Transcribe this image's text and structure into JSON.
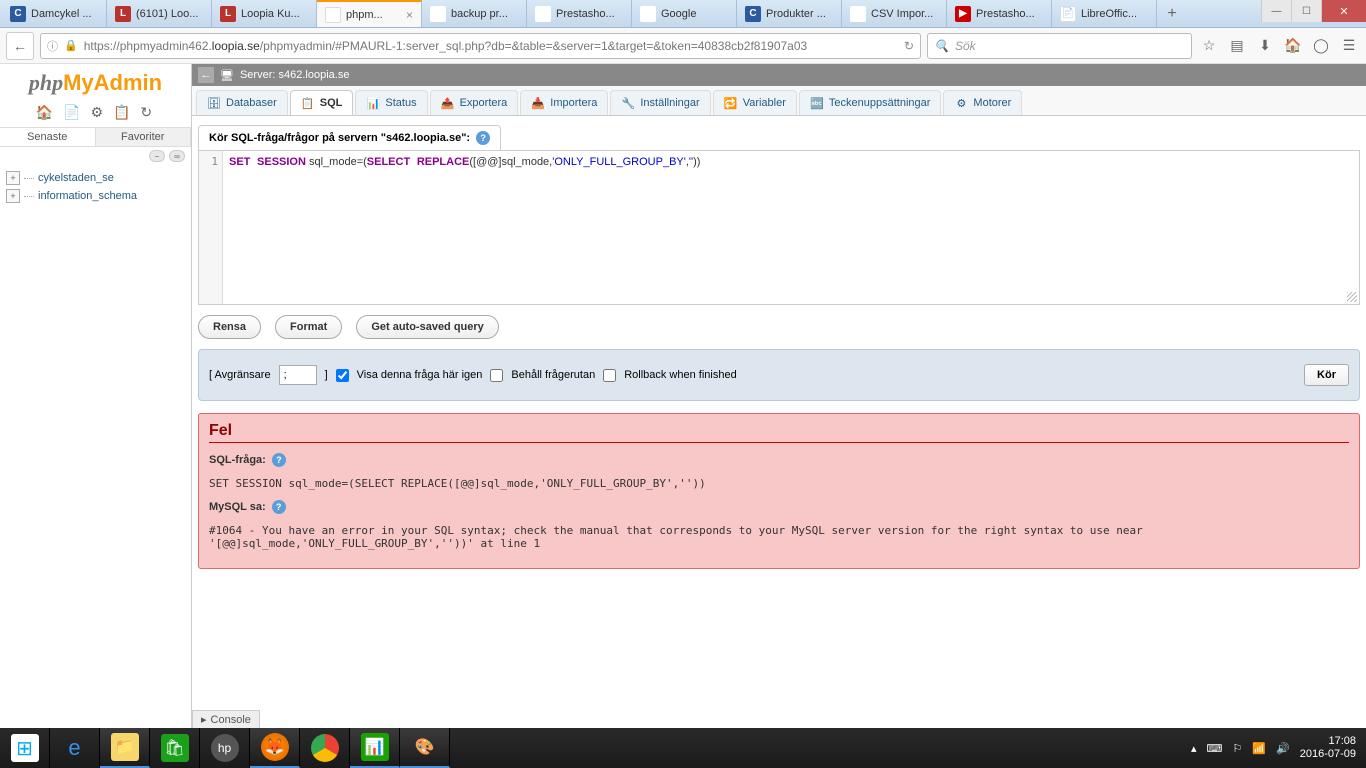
{
  "window": {
    "min": "—",
    "max": "☐"
  },
  "browser_tabs": [
    {
      "icon": "C",
      "icon_class": "fav-c",
      "label": "Damcykel ..."
    },
    {
      "icon": "L",
      "icon_class": "fav-l",
      "label": "(6101) Loo..."
    },
    {
      "icon": "L",
      "icon_class": "fav-l",
      "label": "Loopia Ku..."
    },
    {
      "icon": "⚙",
      "icon_class": "fav-pma",
      "label": "phpm...",
      "active": true,
      "closeable": true
    },
    {
      "icon": "G",
      "icon_class": "fav-g",
      "label": "backup pr..."
    },
    {
      "icon": "⚙",
      "icon_class": "fav-ps",
      "label": "Prestasho..."
    },
    {
      "icon": "G",
      "icon_class": "fav-g",
      "label": "Google"
    },
    {
      "icon": "C",
      "icon_class": "fav-c",
      "label": "Produkter ..."
    },
    {
      "icon": "⚙",
      "icon_class": "fav-ps",
      "label": "CSV Impor..."
    },
    {
      "icon": "▶",
      "icon_class": "fav-yt",
      "label": "Prestasho..."
    },
    {
      "icon": "📄",
      "icon_class": "fav-lo",
      "label": "LibreOffic..."
    }
  ],
  "newtab": "+",
  "url": {
    "prefix": "https://phpmyadmin462.",
    "host": "loopia.se",
    "path": "/phpmyadmin/#PMAURL-1:server_sql.php?db=&table=&server=1&target=&token=40838cb2f81907a03"
  },
  "search_placeholder": "Sök",
  "logo": {
    "php": "php",
    "my": "My",
    "admin": "Admin"
  },
  "sidebar_tabs": {
    "recent": "Senaste",
    "fav": "Favoriter"
  },
  "databases": [
    "cykelstaden_se",
    "information_schema"
  ],
  "breadcrumb": {
    "back": "←",
    "server_label": "Server:",
    "server": "s462.loopia.se"
  },
  "pma_tabs": [
    {
      "icon": "🗄",
      "label": "Databaser"
    },
    {
      "icon": "📋",
      "label": "SQL",
      "active": true
    },
    {
      "icon": "📊",
      "label": "Status"
    },
    {
      "icon": "📤",
      "label": "Exportera"
    },
    {
      "icon": "📥",
      "label": "Importera"
    },
    {
      "icon": "🔧",
      "label": "Inställningar"
    },
    {
      "icon": "🔁",
      "label": "Variabler"
    },
    {
      "icon": "🔤",
      "label": "Teckenuppsättningar"
    },
    {
      "icon": "⚙",
      "label": "Motorer"
    }
  ],
  "panel_title": "Kör SQL-fråga/frågor på servern \"s462.loopia.se\":",
  "sql": {
    "line_no": "1",
    "kw1": "SET",
    "kw2": "SESSION",
    "var": " sql_mode=(",
    "kw3": "SELECT",
    "func": "REPLACE",
    "open": "([@@]sql_mode,",
    "str": "'ONLY_FULL_GROUP_BY'",
    "mid": ",",
    "str2": "''",
    "close": "))"
  },
  "buttons": {
    "clear": "Rensa",
    "format": "Format",
    "autosave": "Get auto-saved query"
  },
  "options": {
    "delimiter_label_open": "[ Avgränsare",
    "delimiter_value": ";",
    "delimiter_label_close": "]",
    "show_again": "Visa denna fråga här igen",
    "keep_box": "Behåll frågerutan",
    "rollback": "Rollback when finished",
    "run": "Kör"
  },
  "error": {
    "title": "Fel",
    "sql_label": "SQL-fråga:",
    "sql_text": "SET SESSION sql_mode=(SELECT REPLACE([@@]sql_mode,'ONLY_FULL_GROUP_BY',''))",
    "mysql_label": "MySQL sa:",
    "mysql_text": "#1064 - You have an error in your SQL syntax; check the manual that corresponds to your MySQL server version for the right syntax to use near '[@@]sql_mode,'ONLY_FULL_GROUP_BY',''))' at line 1"
  },
  "console": "Console",
  "tray": {
    "time": "17:08",
    "date": "2016-07-09"
  }
}
